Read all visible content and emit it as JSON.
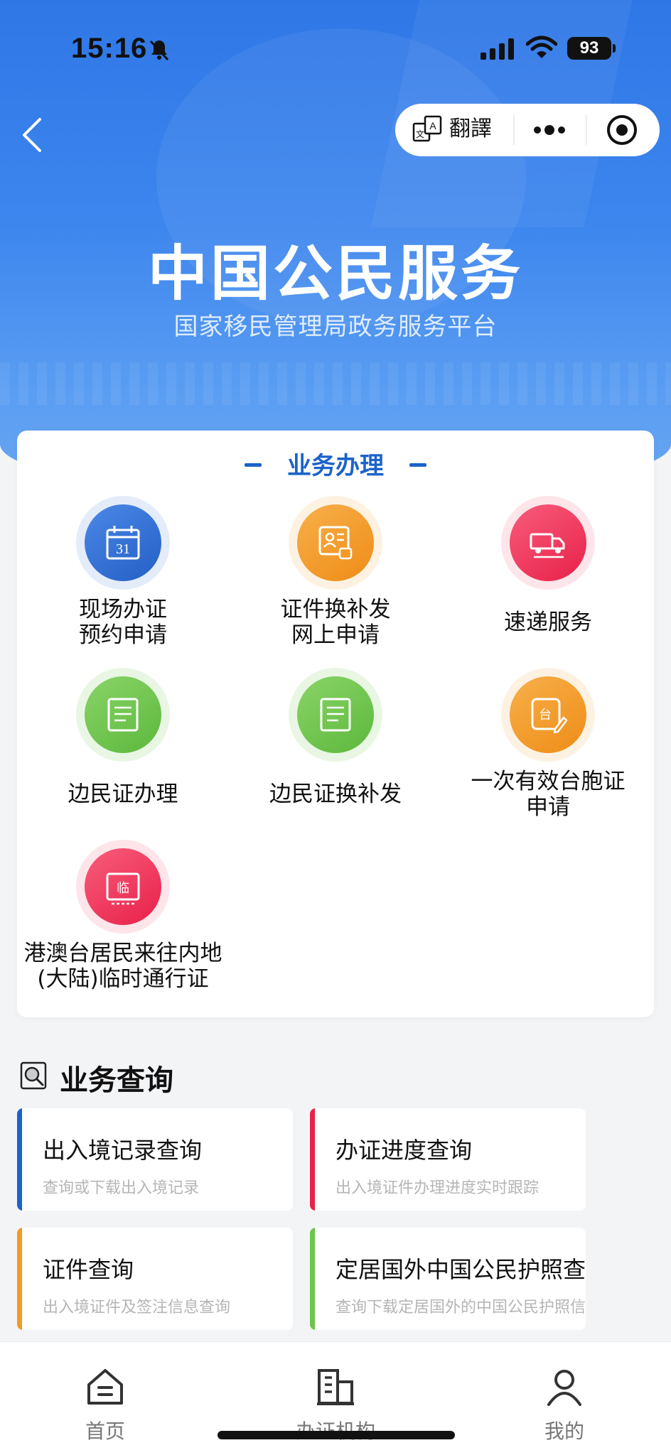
{
  "status_bar": {
    "time": "15:16",
    "battery": "93"
  },
  "nav": {
    "translate_label": "翻譯"
  },
  "hero": {
    "title": "中国公民服务",
    "subtitle": "国家移民管理局政务服务平台"
  },
  "services": {
    "title": "业务办理",
    "items": [
      {
        "label": "现场办证\n预约申请",
        "icon": "calendar-icon",
        "color": "#2f6fd6"
      },
      {
        "label": "证件换补发\n网上申请",
        "icon": "id-card-icon",
        "color": "#f39a22"
      },
      {
        "label": "速递服务",
        "icon": "truck-icon",
        "color": "#f0345a"
      },
      {
        "label": "边民证办理",
        "icon": "document-icon",
        "color": "#6cc54c"
      },
      {
        "label": "边民证换补发",
        "icon": "document-icon",
        "color": "#6cc54c"
      },
      {
        "label": "一次有效台胞证\n申请",
        "icon": "taiwan-permit-icon",
        "color": "#f39a22"
      },
      {
        "label": "港澳台居民来往内地\n(大陆)临时通行证",
        "icon": "temporary-permit-icon",
        "color": "#f0345a"
      }
    ]
  },
  "query": {
    "title": "业务查询",
    "items": [
      {
        "title": "出入境记录查询",
        "desc": "查询或下载出入境记录",
        "color": "#1b63c9"
      },
      {
        "title": "办证进度查询",
        "desc": "出入境证件办理进度实时跟踪",
        "color": "#e8234a"
      },
      {
        "title": "证件查询",
        "desc": "出入境证件及签注信息查询",
        "color": "#f39a22"
      },
      {
        "title": "定居国外中国公民护照查询",
        "desc": "查询下载定居国外的中国公民护照信息",
        "color": "#6cc54c"
      }
    ]
  },
  "tabbar": {
    "items": [
      "首页",
      "办证机构",
      "我的"
    ]
  }
}
